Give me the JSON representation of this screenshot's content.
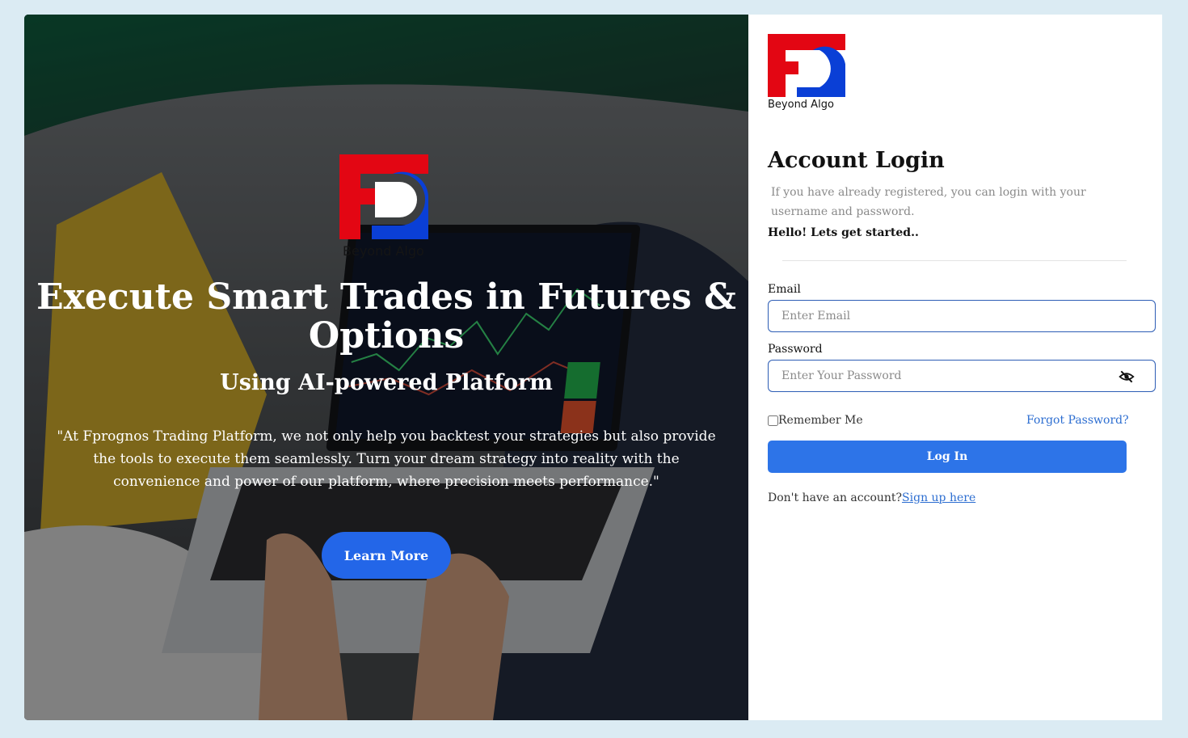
{
  "hero": {
    "logo_tagline": "Beyond Algo",
    "title": "Execute Smart Trades in Futures & Options",
    "subtitle": "Using AI-powered Platform",
    "quote": "\"At Fprognos Trading Platform, we not only help you backtest your strategies but also provide the tools to execute them seamlessly. Turn your dream strategy into reality with the convenience and power of our platform, where precision meets performance.\"",
    "cta_label": "Learn More"
  },
  "brand": {
    "tagline": "Beyond Algo",
    "colors": {
      "red": "#e30613",
      "blue": "#0a3fd6"
    }
  },
  "login": {
    "title": "Account Login",
    "description": "If you have already registered, you can login with your username and password.",
    "greeting": "Hello! Lets get started..",
    "email_label": "Email",
    "email_placeholder": "Enter Email",
    "email_value": "",
    "password_label": "Password",
    "password_placeholder": "Enter Your Password",
    "password_value": "",
    "password_toggle_icon": "eye-slash-icon",
    "remember_label": "Remember Me",
    "forgot_label": "Forgot Password?",
    "submit_label": "Log In",
    "signup_prompt": "Don't have an account?",
    "signup_link": "Sign up here",
    "accent": "#2d74e8"
  }
}
